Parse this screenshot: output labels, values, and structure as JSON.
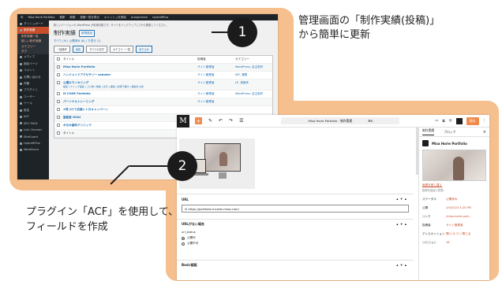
{
  "annotations": {
    "step1": {
      "number": "1",
      "text_line1": "管理画面の「制作実績(投稿)」",
      "text_line2": "から簡単に更新"
    },
    "step2": {
      "number": "2",
      "text_line1": "プラグイン「ACF」を使用して、",
      "text_line2": "フィールドを作成"
    }
  },
  "wp_admin": {
    "topbar": [
      "Misa Horie Portfolio",
      "更新",
      "新規",
      "投稿一覧を表示",
      "キャッシュを削除",
      "Autoptimize",
      "UpdraftPlus"
    ],
    "notice": "新しいバージョンの WordPress が利用可能です。サイトをバックアップしてから更新してください。",
    "sidebar": [
      {
        "label": "ダッシュボード",
        "active": false,
        "sub": false
      },
      {
        "label": "制作実績",
        "active": true,
        "sub": false
      },
      {
        "label": "制作実績一覧",
        "active": false,
        "sub": true
      },
      {
        "label": "新しい制作実績",
        "active": false,
        "sub": true
      },
      {
        "label": "カテゴリー",
        "active": false,
        "sub": true
      },
      {
        "label": "タグ",
        "active": false,
        "sub": true
      },
      {
        "label": "メディア",
        "active": false,
        "sub": false
      },
      {
        "label": "固定ページ",
        "active": false,
        "sub": false
      },
      {
        "label": "コメント",
        "active": false,
        "sub": false
      },
      {
        "label": "お問い合わせ",
        "active": false,
        "sub": false
      },
      {
        "label": "外観",
        "active": false,
        "sub": false
      },
      {
        "label": "プラグイン",
        "active": false,
        "sub": false
      },
      {
        "label": "ユーザー",
        "active": false,
        "sub": false
      },
      {
        "label": "ツール",
        "active": false,
        "sub": false
      },
      {
        "label": "設定",
        "active": false,
        "sub": false
      },
      {
        "label": "ACF",
        "active": false,
        "sub": false
      },
      {
        "label": "SEO PACK",
        "active": false,
        "sub": false
      },
      {
        "label": "Link Checker",
        "active": false,
        "sub": false
      },
      {
        "label": "SiteGuard",
        "active": false,
        "sub": false
      },
      {
        "label": "UpdraftPlus",
        "active": false,
        "sub": false
      },
      {
        "label": "Wordfence",
        "active": false,
        "sub": false
      }
    ],
    "page_title": "制作実績",
    "add_new": "新規追加",
    "filters": "すべて (9) | 公開済み (8) | 下書き (1)",
    "bulk_action": "一括操作",
    "apply": "適用",
    "date_filter": "すべての日付",
    "category_filter": "カテゴリー一覧",
    "filter_btn": "絞り込み",
    "columns": {
      "title": "タイトル",
      "author": "投稿者",
      "category": "カテゴリー"
    },
    "rows": [
      {
        "title": "Misa Horie Portfolio",
        "sub": "",
        "author": "サイト管理者",
        "category": "WordPress, 自主制作"
      },
      {
        "title": "ハンドメイドアクセサリー saboker",
        "sub": "",
        "author": "サイト管理者",
        "category": "WP, 課題"
      },
      {
        "title": "心理カウンセリング",
        "sub": "編集 | クイック編集 | ゴミ箱へ移動 | 表示 | 複製 | 新規下書き | 複製を公開",
        "author": "サイト管理者",
        "category": "LP, 実案件"
      },
      {
        "title": "M CODE Portfolio",
        "sub": "",
        "author": "サイト管理者",
        "category": "WordPress, 自主制作"
      },
      {
        "title": "パーソナルトレーニング",
        "sub": "",
        "author": "サイト管理者",
        "category": ""
      },
      {
        "title": "#見つけて応援レトロキャンペーン",
        "sub": "",
        "author": "",
        "category": ""
      },
      {
        "title": "歯医者 GHAI",
        "sub": "",
        "author": "",
        "category": ""
      },
      {
        "title": "みなみ歯科クリニック",
        "sub": "",
        "author": "",
        "category": ""
      }
    ],
    "footer_title": "タイトル"
  },
  "editor": {
    "logo": "M",
    "doc_title": "Misa Horie Portfolio · 制作実績",
    "shortcut": "⌘K",
    "save": "保存",
    "sections": {
      "url": "URL",
      "url_value": "https://portfolio.mcode-misa.com/",
      "url_none": "URLがない場合",
      "url_status": "url_status",
      "radio_public": "公開可",
      "radio_private": "公開不可",
      "basic": "Basic認証"
    },
    "sidebar": {
      "tab_post": "制作実績",
      "tab_block": "ブロック",
      "post_title": "Misa Horie Portfolio",
      "featured_link": "画像を差し替え",
      "excerpt": "抜粋を追加 (任意)",
      "props": [
        {
          "k": "ステータス",
          "v": "公開済み"
        },
        {
          "k": "公開",
          "v": "2/9/2023 4:25 PM"
        },
        {
          "k": "リンク",
          "v": "/misa-horie-port..."
        },
        {
          "k": "投稿者",
          "v": "サイト管理者"
        },
        {
          "k": "ディスカッション",
          "v": "開く(オフ) / 閉じる"
        },
        {
          "k": "リビジョン",
          "v": "16"
        }
      ]
    }
  },
  "colors": {
    "accent": "#f5bf8e",
    "wp_active": "#c94f2c",
    "editor_save": "#f08a4b"
  }
}
